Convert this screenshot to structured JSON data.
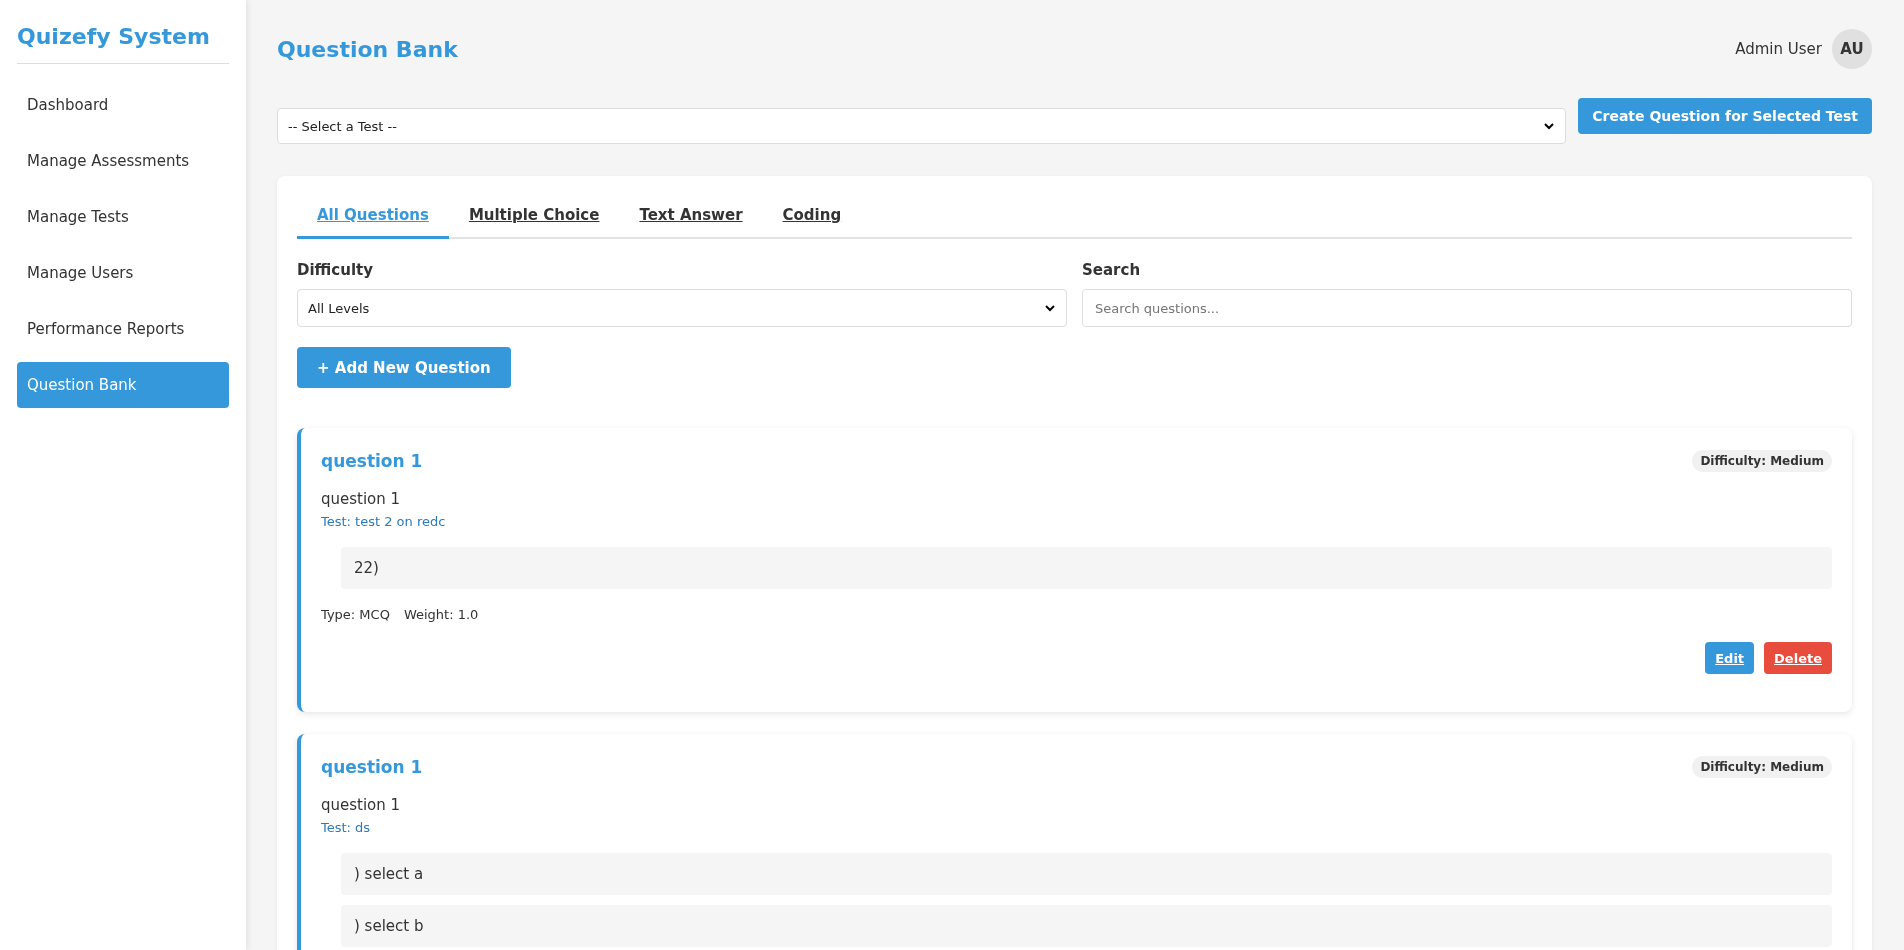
{
  "sidebar": {
    "title": "Quizefy System",
    "items": [
      {
        "label": "Dashboard",
        "selected": false
      },
      {
        "label": "Manage Assessments",
        "selected": false
      },
      {
        "label": "Manage Tests",
        "selected": false
      },
      {
        "label": "Manage Users",
        "selected": false
      },
      {
        "label": "Performance Reports",
        "selected": false
      },
      {
        "label": "Question Bank",
        "selected": true
      }
    ]
  },
  "header": {
    "title": "Question Bank",
    "user_name": "Admin User",
    "avatar": "AU"
  },
  "test_select": {
    "value": "-- Select a Test --"
  },
  "create_button": "Create Question for Selected Test",
  "tabs": [
    {
      "label": "All Questions",
      "selected": true
    },
    {
      "label": "Multiple Choice",
      "selected": false
    },
    {
      "label": "Text Answer",
      "selected": false
    },
    {
      "label": "Coding",
      "selected": false
    }
  ],
  "filters": {
    "difficulty_label": "Difficulty",
    "difficulty_value": "All Levels",
    "search_label": "Search",
    "search_placeholder": "Search questions..."
  },
  "add_button": "+ Add New Question",
  "questions": [
    {
      "title": "question 1",
      "difficulty": "Difficulty: Medium",
      "text": "question 1",
      "test": "Test: test 2 on redc",
      "options": [
        "22)"
      ],
      "type": "Type: MCQ",
      "weight": "Weight: 1.0",
      "actions": [
        {
          "label": "Edit",
          "kind": "edit"
        },
        {
          "label": "Delete",
          "kind": "delete"
        }
      ]
    },
    {
      "title": "question 1",
      "difficulty": "Difficulty: Medium",
      "text": "question 1",
      "test": "Test: ds",
      "options": [
        ") select a",
        ") select b"
      ]
    }
  ]
}
